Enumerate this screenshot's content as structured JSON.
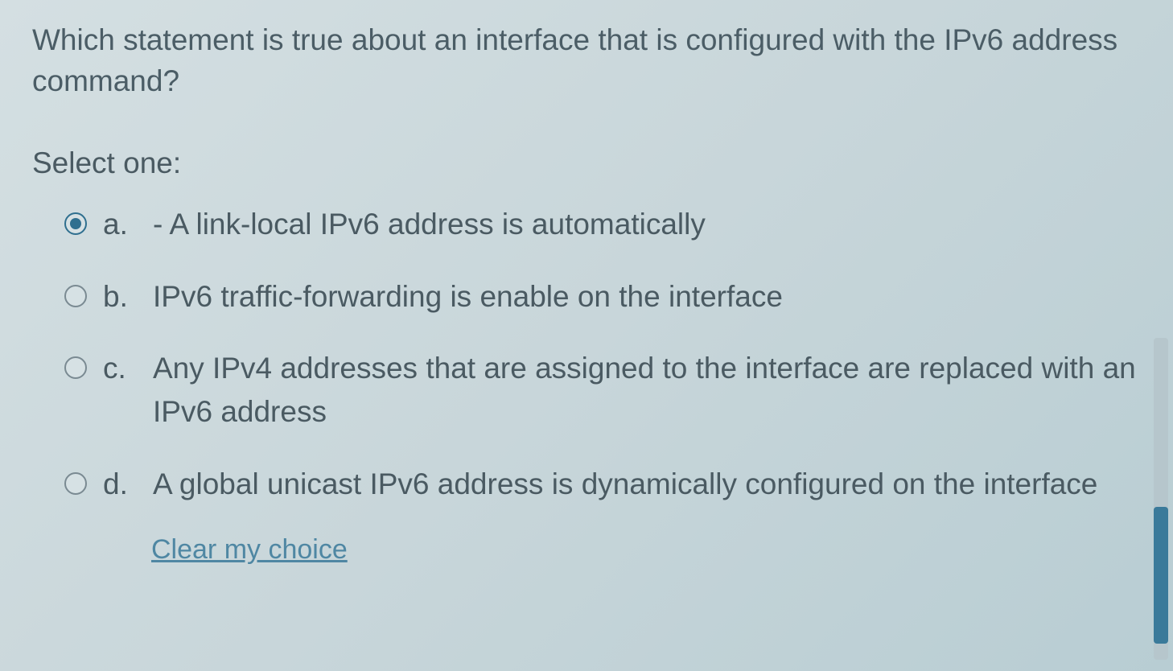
{
  "question": "Which statement is true about an interface that is configured with the IPv6 address command?",
  "select_label": "Select one:",
  "options": [
    {
      "letter": "a.",
      "text": "  - A link-local IPv6 address is automatically",
      "checked": true
    },
    {
      "letter": "b.",
      "text": "IPv6 traffic-forwarding is enable on the interface",
      "checked": false
    },
    {
      "letter": "c.",
      "text": "Any IPv4 addresses that are assigned to the interface are replaced with an IPv6 address",
      "checked": false
    },
    {
      "letter": "d.",
      "text": "A global unicast IPv6 address is dynamically configured on the interface",
      "checked": false
    }
  ],
  "clear_label": "Clear my choice"
}
